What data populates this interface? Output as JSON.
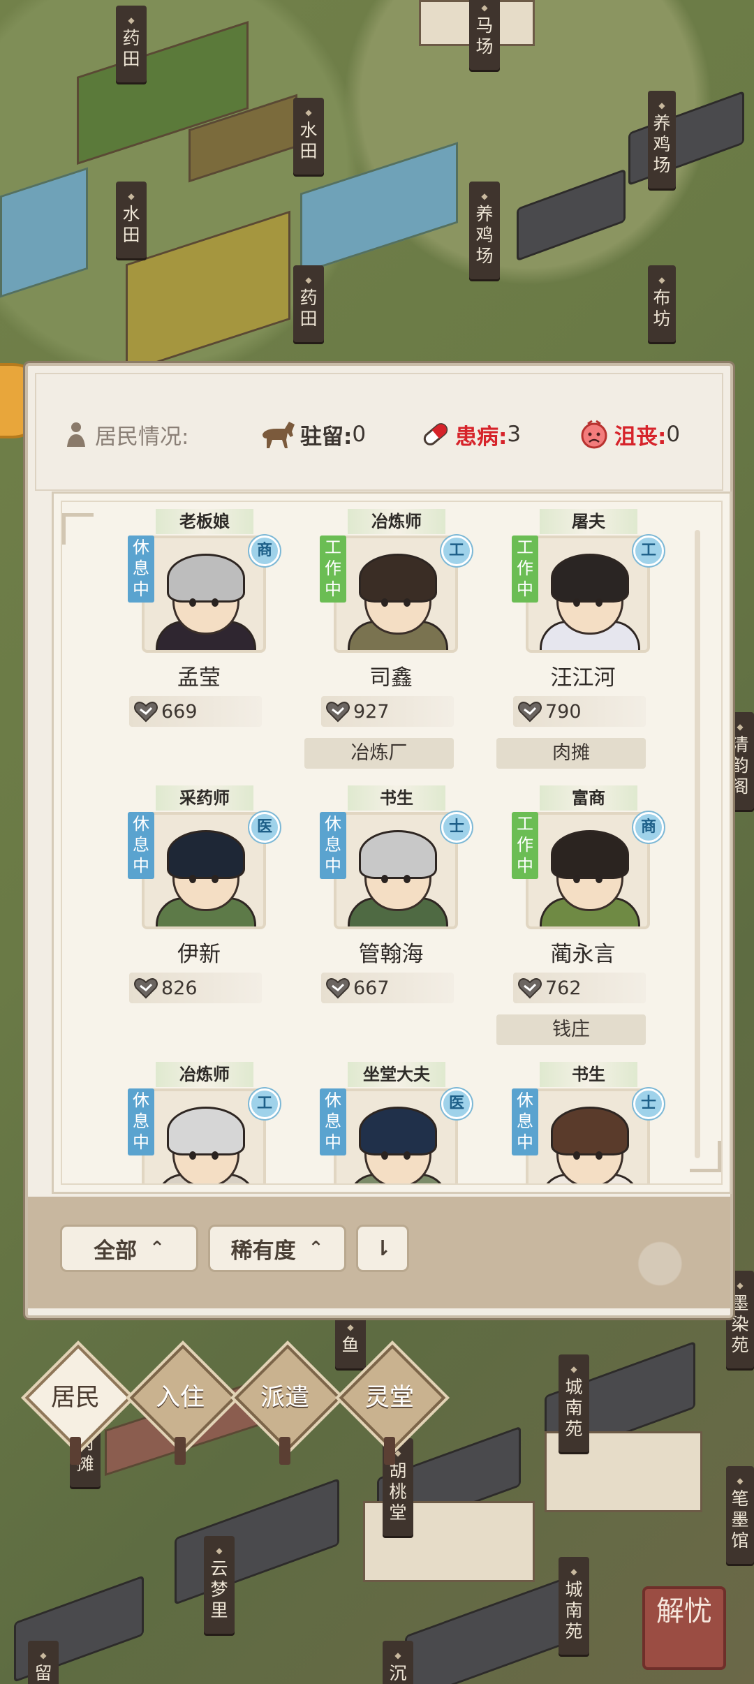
{
  "map_signs": [
    {
      "text": "药田"
    },
    {
      "text": "马场"
    },
    {
      "text": "水田"
    },
    {
      "text": "水田"
    },
    {
      "text": "养鸡场"
    },
    {
      "text": "养鸡场"
    },
    {
      "text": "药田"
    },
    {
      "text": "布坊"
    },
    {
      "text": "城南苑"
    },
    {
      "text": "城南苑"
    },
    {
      "text": "胡桃堂"
    },
    {
      "text": "云梦里"
    },
    {
      "text": "肉摊"
    },
    {
      "text": "鱼"
    },
    {
      "text": "笔墨馆"
    },
    {
      "text": "墨染苑"
    },
    {
      "text": "清韵阁"
    },
    {
      "text": "留"
    },
    {
      "text": "沉"
    }
  ],
  "header": {
    "residents_label": "居民情况:",
    "stay_label": "驻留:",
    "stay_value": "0",
    "sick_label": "患病:",
    "sick_value": "3",
    "depressed_label": "沮丧:",
    "depressed_value": "0"
  },
  "residents": [
    {
      "job": "老板娘",
      "status": "休息中",
      "class": "商",
      "name": "孟莹",
      "value": "669",
      "place": ""
    },
    {
      "job": "冶炼师",
      "status": "工作中",
      "class": "工",
      "name": "司鑫",
      "value": "927",
      "place": "冶炼厂"
    },
    {
      "job": "屠夫",
      "status": "工作中",
      "class": "工",
      "name": "汪江河",
      "value": "790",
      "place": "肉摊"
    },
    {
      "job": "采药师",
      "status": "休息中",
      "class": "医",
      "name": "伊新",
      "value": "826",
      "place": ""
    },
    {
      "job": "书生",
      "status": "休息中",
      "class": "士",
      "name": "管翰海",
      "value": "667",
      "place": ""
    },
    {
      "job": "富商",
      "status": "工作中",
      "class": "商",
      "name": "蔺永言",
      "value": "762",
      "place": "钱庄"
    },
    {
      "job": "冶炼师",
      "status": "休息中",
      "class": "工",
      "name": "",
      "value": "",
      "place": ""
    },
    {
      "job": "坐堂大夫",
      "status": "休息中",
      "class": "医",
      "name": "",
      "value": "",
      "place": ""
    },
    {
      "job": "书生",
      "status": "休息中",
      "class": "士",
      "name": "",
      "value": "",
      "place": ""
    }
  ],
  "footer": {
    "filter_label": "全部",
    "sort_label": "稀有度",
    "filter_arrow": "⌃",
    "sort_arrow": "⌃",
    "order_label": "⇂"
  },
  "tabs": [
    {
      "label": "居民"
    },
    {
      "label": "入住"
    },
    {
      "label": "派遣"
    },
    {
      "label": "灵堂"
    }
  ],
  "stamp": "解忧",
  "colors": {
    "rest_status": "#5aa3cf",
    "work_status": "#6bbd54",
    "sick": "#d6232a",
    "depressed": "#d6232a",
    "class_badge": "#9fd2ea"
  },
  "icons": {
    "residents": "person-icon",
    "stay": "horse-icon",
    "sick": "pill-icon",
    "depressed": "sad-face-icon",
    "stat": "heart-icon"
  }
}
